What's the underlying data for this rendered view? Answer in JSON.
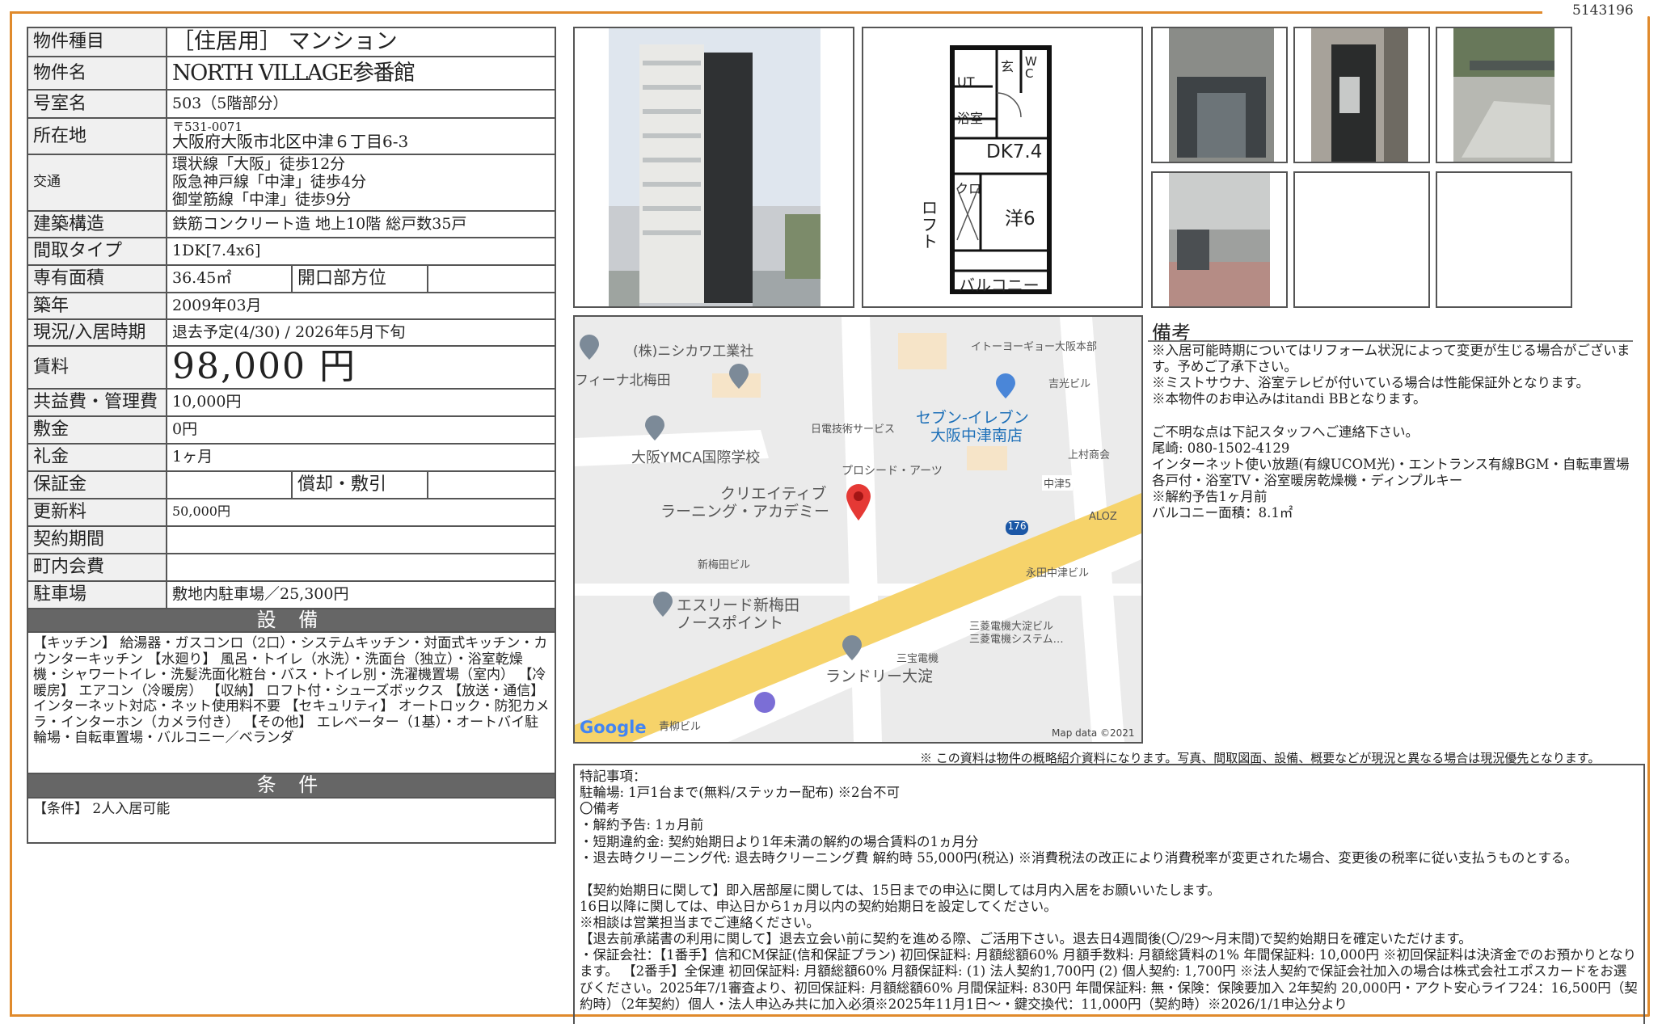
{
  "doc_id": "5143196",
  "spec": {
    "type": {
      "label": "物件種目",
      "value": "［住居用］ マンション"
    },
    "name": {
      "label": "物件名",
      "value": "NORTH VILLAGE参番館"
    },
    "room": {
      "label": "号室名",
      "value": "503（5階部分）"
    },
    "address": {
      "label": "所在地",
      "zip": "〒531-0071",
      "value": "大阪府大阪市北区中津６丁目6-3"
    },
    "traffic": {
      "label": "交通",
      "lines": [
        "環状線「大阪」徒歩12分",
        "阪急神戸線「中津」徒歩4分",
        "御堂筋線「中津」徒歩9分"
      ]
    },
    "structure": {
      "label": "建築構造",
      "value": "鉄筋コンクリート造 地上10階 総戸数35戸"
    },
    "layout": {
      "label": "間取タイプ",
      "value": "1DK[7.4x6]"
    },
    "area": {
      "label": "専有面積",
      "value": "36.45㎡",
      "label2": "開口部方位",
      "value2": ""
    },
    "built": {
      "label": "築年",
      "value": "2009年03月"
    },
    "status": {
      "label": "現況/入居時期",
      "value": "退去予定(4/30)  /  2026年5月下旬"
    },
    "rent": {
      "label": "賃料",
      "value": "98,000 円"
    },
    "fee": {
      "label": "共益費・管理費",
      "value": "10,000円"
    },
    "deposit": {
      "label": "敷金",
      "value": "0円"
    },
    "keymoney": {
      "label": "礼金",
      "value": "1ヶ月"
    },
    "security": {
      "label": "保証金",
      "value": "",
      "label2": "償却・敷引",
      "value2": ""
    },
    "renewal": {
      "label": "更新料",
      "value": "50,000円"
    },
    "contract": {
      "label": "契約期間",
      "value": ""
    },
    "community": {
      "label": "町内会費",
      "value": ""
    },
    "parking": {
      "label": "駐車場",
      "value": "敷地内駐車場／25,300円"
    }
  },
  "equipment": {
    "heading": "設 備",
    "text": "【キッチン】 給湯器・ガスコンロ（2口）・システムキッチン・対面式キッチン・カウンターキッチン 【水廻り】 風呂・トイレ（水洗）・洗面台（独立）・浴室乾燥機・シャワートイレ・洗髪洗面化粧台・バス・トイレ別・洗濯機置場（室内） 【冷暖房】 エアコン（冷暖房） 【収納】 ロフト付・シューズボックス 【放送・通信】 インターネット対応・ネット使用料不要 【セキュリティ】 オートロック・防犯カメラ・インターホン（カメラ付き） 【その他】 エレベーター（1基）・オートバイ駐輪場・自転車置場・バルコニー／ベランダ"
  },
  "conditions": {
    "heading": "条 件",
    "text": "【条件】 2人入居可能"
  },
  "floorplan": {
    "genkan": "玄",
    "wc": "W\nC",
    "ut": "UT",
    "bath": "浴室",
    "dk": "DK7.4",
    "closet": "クロ",
    "western": "洋6",
    "loft": "ロフト",
    "balcony": "バルコニー"
  },
  "map": {
    "labels": {
      "nishikawa": "(株)ニシカワ工業社",
      "fina": "フィーナ北梅田",
      "itoyokado": "イトーヨーギョー大阪本部",
      "yoshimitsu": "吉光ビル",
      "ymca": "大阪YMCA国際学校",
      "nichiden": "日電技術サービス",
      "seven1": "セブン-イレブン",
      "seven2": "大阪中津南店",
      "kamimura": "上村商会",
      "proseed": "プロシード・アーツ",
      "nakatsu5": "中津5",
      "creative1": "クリエイティブ",
      "creative2": "ラーニング・アカデミー",
      "route": "176",
      "aloz": "ALOZ",
      "shinumeda": "新梅田ビル",
      "nagata": "永田中津ビル",
      "esreed1": "エスリード新梅田",
      "esreed2": "ノースポイント",
      "mitsubishi1": "三菱電機大淀ビル",
      "mitsubishi2": "三菱電機システム…",
      "sanpo": "三宝電機",
      "laundry": "ランドリー大淀",
      "aoyagi": "青柳ビル",
      "google": "Google",
      "mapdata": "Map data ©2021"
    }
  },
  "remarks": {
    "title": "備考",
    "lines": [
      "※入居可能時期についてはリフォーム状況によって変更が生じる場合がございます。予めご了承下さい。",
      "※ミストサウナ、浴室テレビが付いている場合は性能保証外となります。",
      "※本物件のお申込みはitandi BBとなります。",
      "",
      "ご不明な点は下記スタッフへご連絡下さい。",
      "尾崎: 080-1502-4129",
      "インターネット使い放題(有線UCOM光)・エントランス有線BGM・自転車置場各戸付・浴室TV・浴室暖房乾燥機・ディンプルキー",
      "※解約予告1ヶ月前",
      "バルコニー面積：8.1㎡"
    ]
  },
  "disclaimer": "※ この資料は物件の概略紹介資料になります。写真、間取図面、設備、概要などが現況と異なる場合は現況優先となります。",
  "notes": {
    "lines": [
      "特記事項：",
      "駐輪場: 1戸1台まで(無料/ステッカー配布) ※2台不可",
      "〇備考",
      "・解約予告: 1ヵ月前",
      "・短期違約金: 契約始期日より1年未満の解約の場合賃料の1ヵ月分",
      "・退去時クリーニング代: 退去時クリーニング費 解約時 55,000円(税込) ※消費税法の改正により消費税率が変更された場合、変更後の税率に従い支払うものとする。",
      "",
      "【契約始期日に関して】即入居部屋に関しては、15日までの申込に関しては月内入居をお願いいたします。",
      "16日以降に関しては、申込日から1ヵ月以内の契約始期日を設定してください。",
      "※相談は営業担当までご連絡ください。",
      "【退去前承諾書の利用に関して】退去立会い前に契約を進める際、ご活用下さい。退去日4週間後(〇/29～月末間)で契約始期日を確定いただけます。",
      "・保証会社：【1番手】信和CM保証(信和保証プラン)  初回保証料: 月額総額60%  月額手数料: 月額総賃料の1%  年間保証料: 10,000円   ※初回保証料は決済金でのお預かりとなります。 【2番手】全保連  初回保証料: 月額総額60%  月額保証料: (1) 法人契約1,700円  (2) 個人契約: 1,700円 ※法人契約で保証会社加入の場合は株式会社エポスカードをお選びください。2025年7/1審査より、初回保証料: 月額総額60%  月間保証料: 830円  年間保証料: 無・保険：保険要加入 2年契約 20,000円・アクト安心ライフ24：16,500円（契約時）（2年契約）個人・法人申込み共に加入必須※2025年11月1日～・鍵交換代：11,000円（契約時）※2026/1/1申込分より"
    ]
  },
  "colors": {
    "frame": "#e08a2c",
    "header_bg": "#666666",
    "label_bg": "#f0f0f0",
    "pin": "#e53935"
  }
}
